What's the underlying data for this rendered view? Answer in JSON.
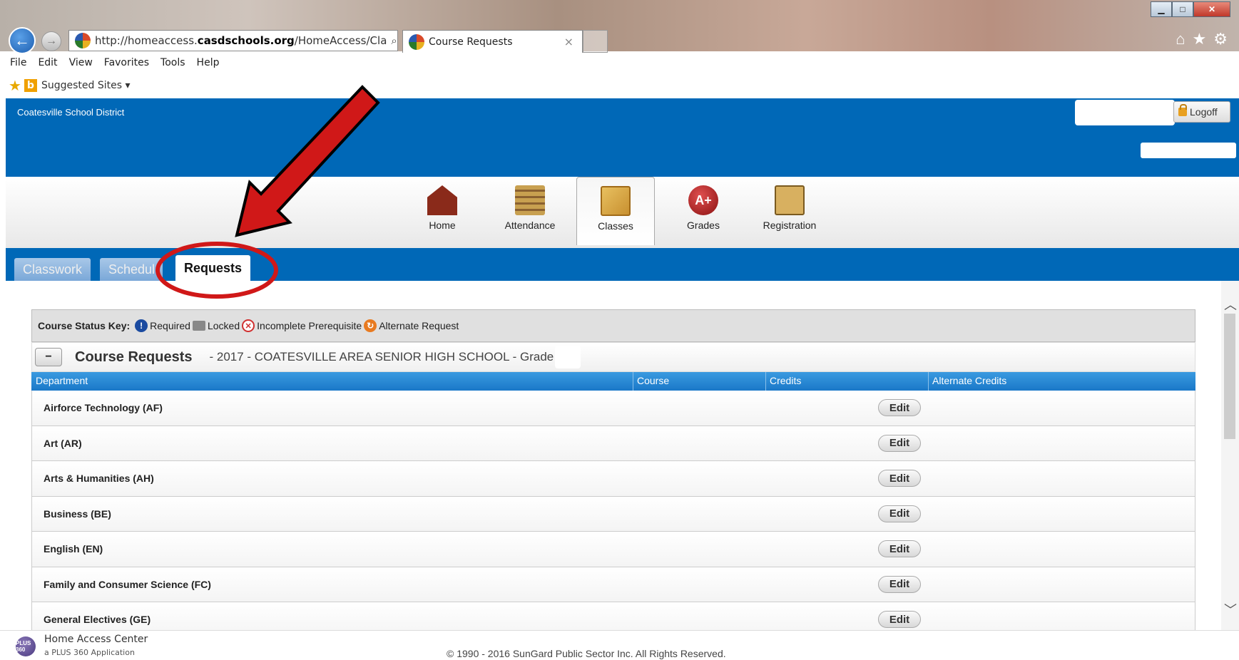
{
  "browser": {
    "url_prefix": "http://homeaccess.",
    "url_domain": "casdschools.org",
    "url_suffix": "/HomeAccess/Cla",
    "url_actions": "⌕ ▾ ↻",
    "tab_title": "Course Requests",
    "tab_close": "×",
    "menu": [
      "File",
      "Edit",
      "View",
      "Favorites",
      "Tools",
      "Help"
    ],
    "favorites": {
      "suggested_sites": "Suggested Sites ▾"
    }
  },
  "header": {
    "district": "Coatesville School District",
    "logoff": "Logoff"
  },
  "nav": {
    "items": [
      {
        "label": "Home",
        "icon": "home-icon"
      },
      {
        "label": "Attendance",
        "icon": "attendance-icon"
      },
      {
        "label": "Classes",
        "icon": "classes-icon",
        "active": true
      },
      {
        "label": "Grades",
        "icon": "grades-icon"
      },
      {
        "label": "Registration",
        "icon": "registration-icon"
      }
    ],
    "grades_badge": "A+"
  },
  "subtabs": {
    "classwork": "Classwork",
    "schedule": "Schedul",
    "requests": "Requests"
  },
  "status_key": {
    "label": "Course Status Key:",
    "required": "Required",
    "locked": "Locked",
    "incomplete": "Incomplete Prerequisite",
    "alternate": "Alternate Request"
  },
  "course_requests": {
    "collapse": "−",
    "title": "Course Requests",
    "subtitle": "- 2017 - COATESVILLE AREA SENIOR HIGH SCHOOL - Grade",
    "columns": {
      "department": "Department",
      "course": "Course",
      "credits": "Credits",
      "alternate_credits": "Alternate Credits"
    },
    "edit_label": "Edit",
    "departments": [
      "Airforce Technology (AF)",
      "Art (AR)",
      "Arts & Humanities (AH)",
      "Business (BE)",
      "English (EN)",
      "Family and Consumer Science (FC)",
      "General Electives (GE)"
    ]
  },
  "footer": {
    "app_name": "Home Access Center",
    "app_sub": "a PLUS 360 Application",
    "logo_text": "PLUS 360",
    "copyright": "© 1990 - 2016 SunGard Public Sector Inc. All Rights Reserved."
  },
  "colors": {
    "brand_blue": "#0068b7",
    "header_blue": "#1a78c8",
    "annotation_red": "#d01818"
  }
}
